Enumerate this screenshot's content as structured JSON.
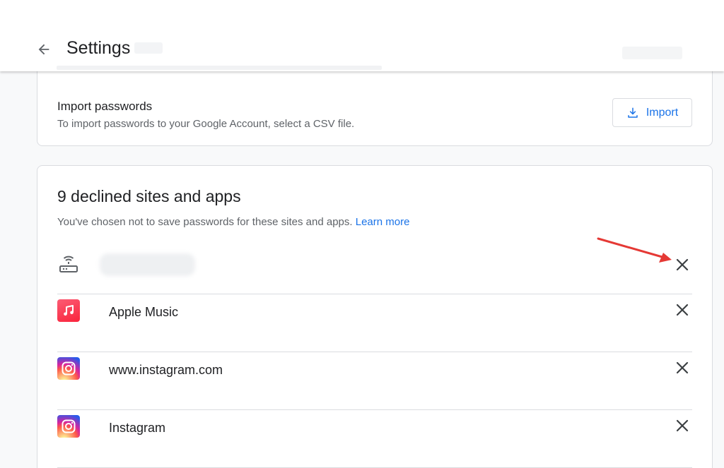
{
  "header": {
    "title": "Settings",
    "back_icon": "arrow-back-icon"
  },
  "import_card": {
    "title": "Import passwords",
    "description": "To import passwords to your Google Account, select a CSV file.",
    "button_label": "Import",
    "button_icon": "download-icon"
  },
  "declined_card": {
    "title": "9 declined sites and apps",
    "description": "You've chosen not to save passwords for these sites and apps.",
    "learn_more": "Learn more",
    "items": [
      {
        "label": "",
        "icon": "router-icon",
        "blurred": true
      },
      {
        "label": "Apple Music",
        "icon": "apple-music-icon"
      },
      {
        "label": "www.instagram.com",
        "icon": "instagram-icon"
      },
      {
        "label": "Instagram",
        "icon": "instagram-icon"
      }
    ]
  },
  "colors": {
    "accent": "#1a73e8",
    "annotation_arrow": "#e53935",
    "background": "#f8f9fa"
  }
}
